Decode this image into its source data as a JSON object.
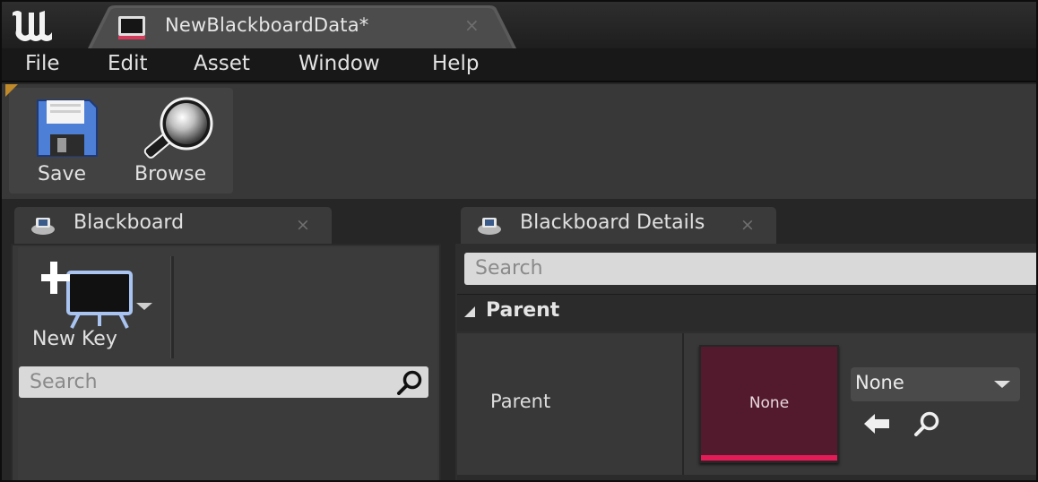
{
  "window": {
    "document_tab": {
      "label": "NewBlackboardData*",
      "close_glyph": "×",
      "icon": "blackboard-asset-icon"
    },
    "logo": "unreal-engine-logo"
  },
  "menu": {
    "items": [
      "File",
      "Edit",
      "Asset",
      "Window",
      "Help"
    ]
  },
  "toolbar": {
    "save_label": "Save",
    "browse_label": "Browse",
    "save_icon": "floppy-disk-icon",
    "browse_icon": "magnifier-icon"
  },
  "blackboard_panel": {
    "tab_label": "Blackboard",
    "tab_close": "×",
    "new_key_label": "New Key",
    "search_placeholder": "Search"
  },
  "details_panel": {
    "tab_label": "Blackboard Details",
    "tab_close": "×",
    "search_placeholder": "Search",
    "section_title": "Parent",
    "property_name": "Parent",
    "thumbnail_label": "None",
    "combo_value": "None"
  },
  "colors": {
    "thumbnail_bg": "#531a2e",
    "thumbnail_accent": "#e21c57",
    "toolbar_marker": "#c08a2a"
  }
}
